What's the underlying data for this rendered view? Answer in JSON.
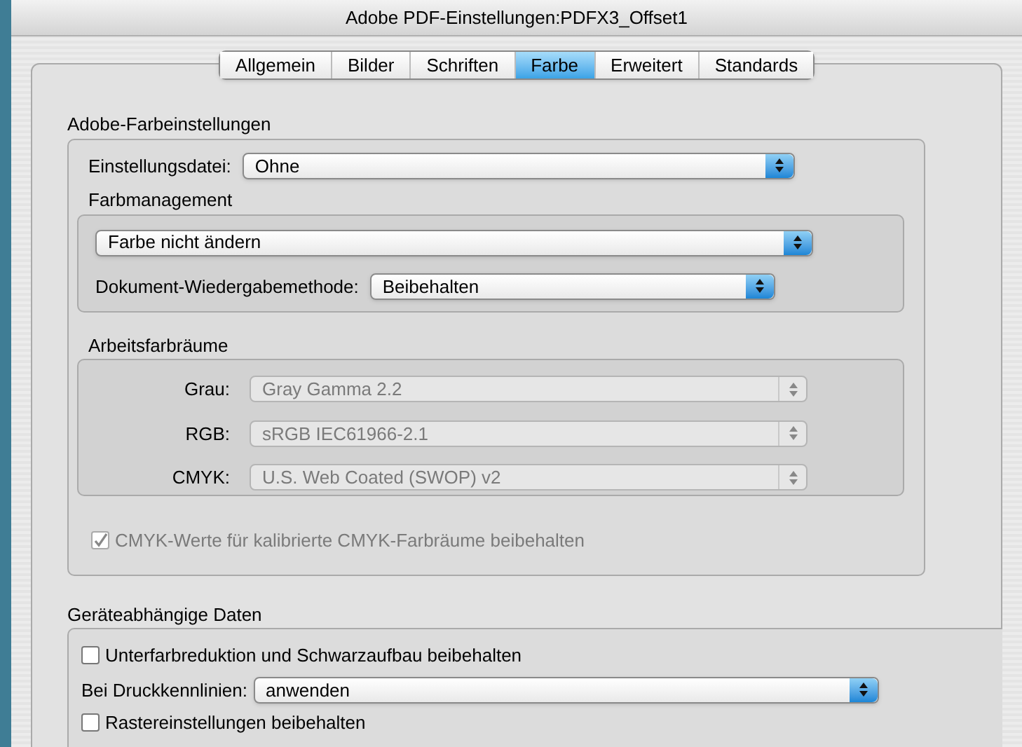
{
  "window": {
    "title": "Adobe PDF-Einstellungen:PDFX3_Offset1"
  },
  "tabs": [
    {
      "label": "Allgemein",
      "selected": false
    },
    {
      "label": "Bilder",
      "selected": false
    },
    {
      "label": "Schriften",
      "selected": false
    },
    {
      "label": "Farbe",
      "selected": true
    },
    {
      "label": "Erweitert",
      "selected": false
    },
    {
      "label": "Standards",
      "selected": false
    }
  ],
  "color_settings": {
    "title": "Adobe-Farbeinstellungen",
    "settings_file": {
      "label": "Einstellungsdatei:",
      "value": "Ohne",
      "disabled": false
    },
    "color_management": {
      "title": "Farbmanagement",
      "policy": {
        "value": "Farbe nicht ändern",
        "disabled": false
      },
      "intent": {
        "label": "Dokument-Wiedergabemethode:",
        "value": "Beibehalten",
        "disabled": false
      }
    },
    "working_spaces": {
      "title": "Arbeitsfarbräume",
      "rows": [
        {
          "label": "Grau:",
          "value": "Gray Gamma 2.2",
          "disabled": true
        },
        {
          "label": "RGB:",
          "value": "sRGB IEC61966-2.1",
          "disabled": true
        },
        {
          "label": "CMYK:",
          "value": "U.S. Web Coated (SWOP) v2",
          "disabled": true
        }
      ]
    },
    "preserve_cmyk": {
      "label": "CMYK-Werte für kalibrierte CMYK-Farbräume beibehalten",
      "checked": true,
      "disabled": true
    }
  },
  "device_data": {
    "title": "Geräteabhängige Daten",
    "ucr": {
      "label": "Unterfarbreduktion und Schwarzaufbau beibehalten",
      "checked": false,
      "disabled": false
    },
    "transfer": {
      "label": "Bei Druckkennlinien:",
      "value": "anwenden",
      "disabled": false
    },
    "halftone": {
      "label": "Rastereinstellungen beibehalten",
      "checked": false,
      "disabled": false
    }
  }
}
